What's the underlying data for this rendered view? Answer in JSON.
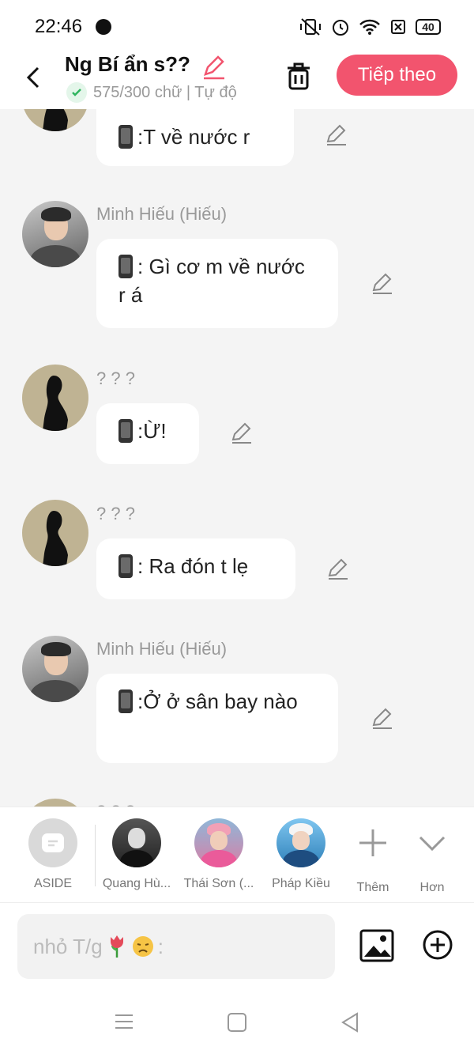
{
  "status": {
    "time": "22:46",
    "battery": "40"
  },
  "header": {
    "title": "Ng Bí ẩn s??",
    "subtitle": "575/300 chữ | Tự độ",
    "next_label": "Tiếp theo"
  },
  "messages": [
    {
      "sender": "",
      "text": ":T về nước r"
    },
    {
      "sender": "Minh Hiếu (Hiếu)",
      "text": ": Gì cơ m về nước r á"
    },
    {
      "sender": "? ? ?",
      "text": ":Ừ!"
    },
    {
      "sender": "? ? ?",
      "text": ": Ra đón t lẹ"
    },
    {
      "sender": "Minh Hiếu (Hiếu)",
      "text": ":Ở ở sân bay nào"
    },
    {
      "sender": "? ? ?",
      "text": ""
    }
  ],
  "shortcuts": [
    {
      "label": "ASIDE",
      "icon": "aside-icon"
    },
    {
      "label": "Quang Hù...",
      "icon": "avatar"
    },
    {
      "label": "Thái Sơn (...",
      "icon": "avatar"
    },
    {
      "label": "Pháp Kiều",
      "icon": "avatar"
    },
    {
      "label": "Thêm",
      "icon": "plus-icon"
    },
    {
      "label": "Hơn",
      "icon": "chevron-down-icon"
    }
  ],
  "input": {
    "placeholder": "nhỏ T/g",
    "emoji": [
      "tulip-icon",
      "sad-face-icon"
    ],
    "suffix": ":"
  },
  "colors": {
    "accent": "#f2546e",
    "background": "#f4f4f4",
    "check": "#2fb55e"
  }
}
